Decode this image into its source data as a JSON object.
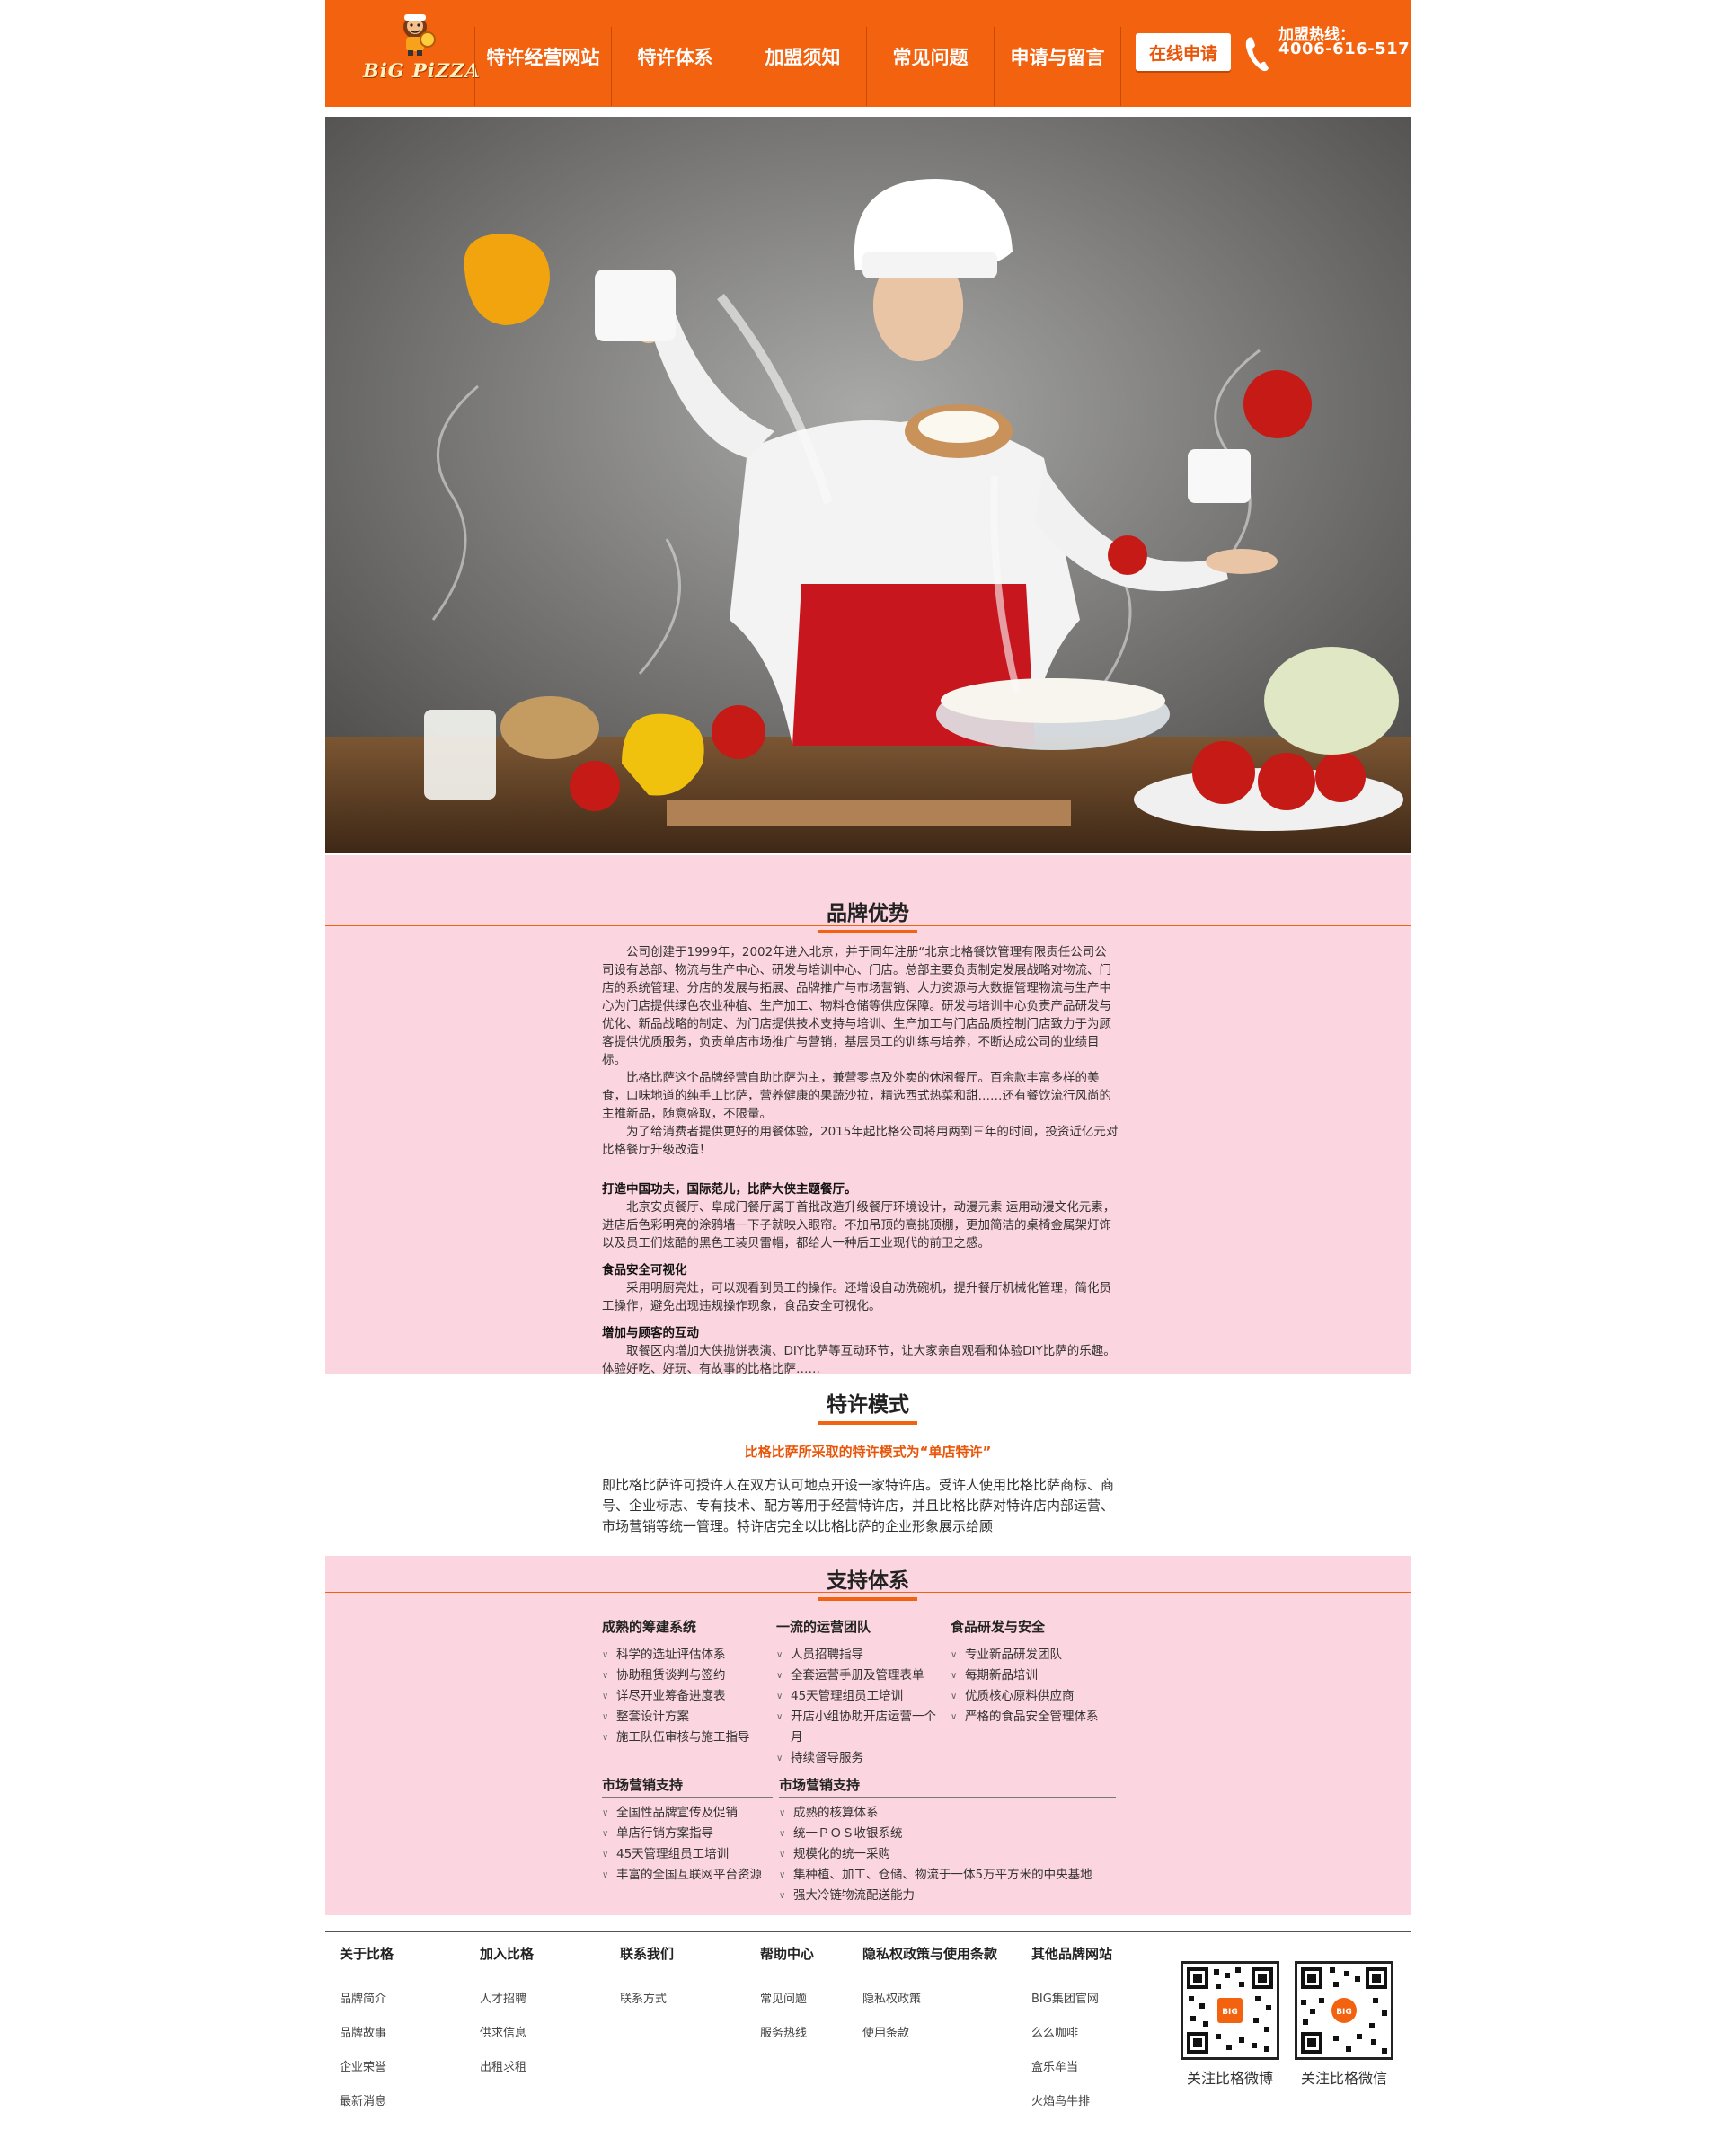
{
  "header": {
    "logo_text": "BiG PiZZA",
    "nav": [
      "特许经营网站",
      "特许体系",
      "加盟须知",
      "常见问题",
      "申请与留言"
    ],
    "apply_button": "在线申请",
    "hotline_label": "加盟热线：",
    "hotline_number": "4006-616-517",
    "accent_color": "#f2620f"
  },
  "brand": {
    "title": "品牌优势",
    "paragraphs": [
      "公司创建于1999年，2002年进入北京，并于同年注册“北京比格餐饮管理有限责任公司公司设有总部、物流与生产中心、研发与培训中心、门店。总部主要负责制定发展战略对物流、门店的系统管理、分店的发展与拓展、品牌推广与市场营销、人力资源与大数据管理物流与生产中心为门店提供绿色农业种植、生产加工、物料仓储等供应保障。研发与培训中心负责产品研发与优化、新品战略的制定、为门店提供技术支持与培训、生产加工与门店品质控制门店致力于为顾客提供优质服务，负责单店市场推广与营销，基层员工的训练与培养，不断达成公司的业绩目标。",
      "比格比萨这个品牌经营自助比萨为主，兼营零点及外卖的休闲餐厅。百余款丰富多样的美食，口味地道的纯手工比萨，营养健康的果蔬沙拉，精选西式热菜和甜……还有餐饮流行风尚的主推新品，随意盛取，不限量。",
      "为了给消费者提供更好的用餐体验，2015年起比格公司将用两到三年的时间，投资近亿元对比格餐厅升级改造！"
    ],
    "features": [
      {
        "title": "打造中国功夫，国际范儿，比萨大侠主题餐厅。",
        "text": "北京安贞餐厅、阜成门餐厅属于首批改造升级餐厅环境设计，动漫元素  运用动漫文化元素，进店后色彩明亮的涂鸦墙一下子就映入眼帘。不加吊顶的高挑顶棚，更加简洁的桌椅金属架灯饰以及员工们炫酷的黑色工装贝雷帽，都给人一种后工业现代的前卫之感。"
      },
      {
        "title": "食品安全可视化",
        "text": "采用明厨亮灶，可以观看到员工的操作。还增设自动洗碗机，提升餐厅机械化管理，简化员工操作，避免出现违规操作现象，食品安全可视化。"
      },
      {
        "title": "增加与顾客的互动",
        "text": "取餐区内增加大侠抛饼表演、DIY比萨等互动环节，让大家亲自观看和体验DIY比萨的乐趣。体验好吃、好玩、有故事的比格比萨……"
      }
    ]
  },
  "model": {
    "title": "特许模式",
    "subtitle": "比格比萨所采取的特许模式为“单店特许”",
    "text": "即比格比萨许可授许人在双方认可地点开设一家特许店。受许人使用比格比萨商标、商号、企业标志、专有技术、配方等用于经营特许店，并且比格比萨对特许店内部运营、市场营销等统一管理。特许店完全以比格比萨的企业形象展示给顾"
  },
  "support": {
    "title": "支持体系",
    "columns": [
      {
        "title": "成熟的筹建系统",
        "items": [
          "科学的选址评估体系",
          "协助租赁谈判与签约",
          "详尽开业筹备进度表",
          "整套设计方案",
          "施工队伍审核与施工指导"
        ]
      },
      {
        "title": "一流的运营团队",
        "items": [
          "人员招聘指导",
          "全套运营手册及管理表单",
          "45天管理组员工培训",
          "开店小组协助开店运营一个月",
          "持续督导服务"
        ]
      },
      {
        "title": "食品研发与安全",
        "items": [
          "专业新品研发团队",
          "每期新品培训",
          "优质核心原料供应商",
          "严格的食品安全管理体系"
        ]
      },
      {
        "title": "市场营销支持",
        "items": [
          "全国性品牌宣传及促销",
          "单店行销方案指导",
          "45天管理组员工培训",
          "丰富的全国互联网平台资源"
        ]
      },
      {
        "title": "市场营销支持",
        "items": [
          "成熟的核算体系",
          "统一ＰＯＳ收银系统",
          "规模化的统一采购",
          "集种植、加工、仓储、物流于一体5万平方米的中央基地",
          "强大冷链物流配送能力"
        ]
      }
    ]
  },
  "footer": {
    "columns": [
      {
        "title": "关于比格",
        "links": [
          "品牌简介",
          "品牌故事",
          "企业荣誉",
          "最新消息"
        ]
      },
      {
        "title": "加入比格",
        "links": [
          "人才招聘",
          "供求信息",
          "出租求租"
        ]
      },
      {
        "title": "联系我们",
        "links": [
          "联系方式"
        ]
      },
      {
        "title": "帮助中心",
        "links": [
          "常见问题",
          "服务热线"
        ]
      },
      {
        "title": "隐私权政策与使用条款",
        "links": [
          "隐私权政策",
          "使用条款"
        ]
      },
      {
        "title": "其他品牌网站",
        "links": [
          "BIG集团官网",
          "么么咖啡",
          "盒乐牟当",
          "火焰鸟牛排"
        ]
      }
    ],
    "qr": [
      {
        "caption": "关注比格微博"
      },
      {
        "caption": "关注比格微信"
      }
    ]
  }
}
